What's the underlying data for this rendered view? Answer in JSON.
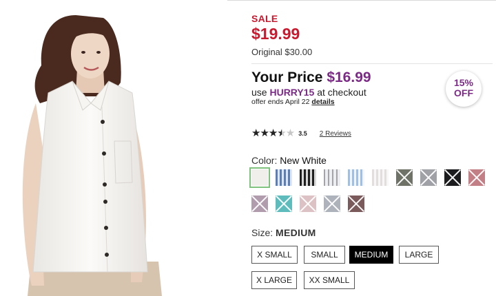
{
  "pricing": {
    "sale_label": "SALE",
    "sale_price": "$19.99",
    "original_price": "Original $30.00",
    "your_price_label": "Your Price",
    "your_price": "$16.99",
    "promo_prefix": "use",
    "promo_code": "HURRY15",
    "promo_suffix": "at checkout",
    "offer_text": "offer ends April 22",
    "details_link": "details",
    "badge_percent": "15%",
    "badge_off": "OFF"
  },
  "rating": {
    "value": "3.5",
    "fraction": 0.7,
    "stars_glyph": "★★★★★",
    "reviews_link": "2 Reviews"
  },
  "color": {
    "label": "Color:",
    "selected": "New White",
    "swatches": [
      {
        "name": "New White",
        "selected": true,
        "available": true,
        "bg": "#f0efeb"
      },
      {
        "name": "Blue Plaid",
        "available": true,
        "bg": "repeating-linear-gradient(90deg,#5a7fb6 0 3px,#dfe6f1 3px 6px),#9bb3d6"
      },
      {
        "name": "Black Plaid",
        "available": true,
        "bg": "repeating-linear-gradient(90deg,#1f1f1f 0 3px,#d8d8d8 3px 6px)"
      },
      {
        "name": "Gray Plaid",
        "available": true,
        "bg": "repeating-linear-gradient(90deg,#a3a3a8 0 2px,#eceef2 2px 6px)"
      },
      {
        "name": "Blue Stripe",
        "available": true,
        "bg": "repeating-linear-gradient(90deg,#9ec0e8 0 3px,#f2f5fb 3px 6px)"
      },
      {
        "name": "Light Plaid",
        "available": true,
        "bg": "repeating-linear-gradient(90deg,#e3dede 0 3px,#f8f6f6 3px 6px)"
      },
      {
        "name": "Olive",
        "available": false,
        "bg": "#6f7367"
      },
      {
        "name": "Gray Check",
        "available": false,
        "bg": "#9fa1a6"
      },
      {
        "name": "Black Check",
        "available": false,
        "bg": "#1c1c1e"
      },
      {
        "name": "Red Plaid",
        "available": false,
        "bg": "#c27f85"
      },
      {
        "name": "Lavender Plaid",
        "available": false,
        "bg": "#b19cae"
      },
      {
        "name": "Teal",
        "available": false,
        "bg": "#5fbcbc"
      },
      {
        "name": "Blush",
        "available": false,
        "bg": "#dcc2c4"
      },
      {
        "name": "Gray Plaid 2",
        "available": false,
        "bg": "#aeb2ba"
      },
      {
        "name": "Mauve",
        "available": false,
        "bg": "#7a5a5a"
      }
    ]
  },
  "size": {
    "label": "Size:",
    "selected": "MEDIUM",
    "options": [
      "X SMALL",
      "SMALL",
      "MEDIUM",
      "LARGE",
      "X LARGE",
      "XX SMALL"
    ]
  },
  "colors": {
    "sale_red": "#c8192e",
    "promo_purple": "#7b2a86",
    "selected_outline": "#7fc27e"
  }
}
